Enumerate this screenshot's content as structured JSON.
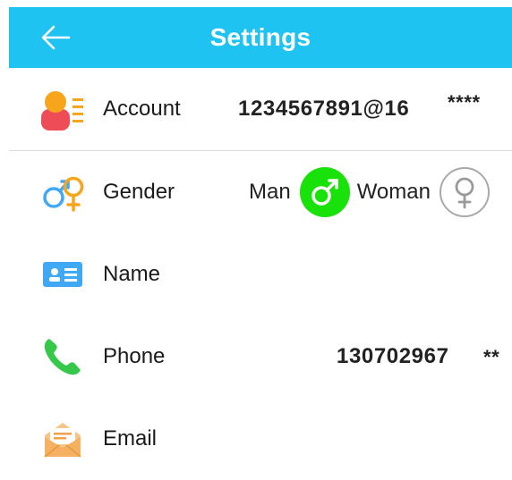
{
  "header": {
    "title": "Settings",
    "back_icon": "back-arrow-icon"
  },
  "colors": {
    "header_bg": "#1fc3f2",
    "selected_gender": "#19e10a"
  },
  "rows": {
    "account": {
      "label": "Account",
      "value": "1234567891@16",
      "masked": "****",
      "icon": "account-icon"
    },
    "gender": {
      "label": "Gender",
      "icon": "gender-icon",
      "options": [
        {
          "label": "Man",
          "selected": true
        },
        {
          "label": "Woman",
          "selected": false
        }
      ]
    },
    "name": {
      "label": "Name",
      "icon": "id-card-icon"
    },
    "phone": {
      "label": "Phone",
      "value": "130702967",
      "masked": "**",
      "icon": "phone-icon"
    },
    "email": {
      "label": "Email",
      "icon": "envelope-icon"
    }
  }
}
